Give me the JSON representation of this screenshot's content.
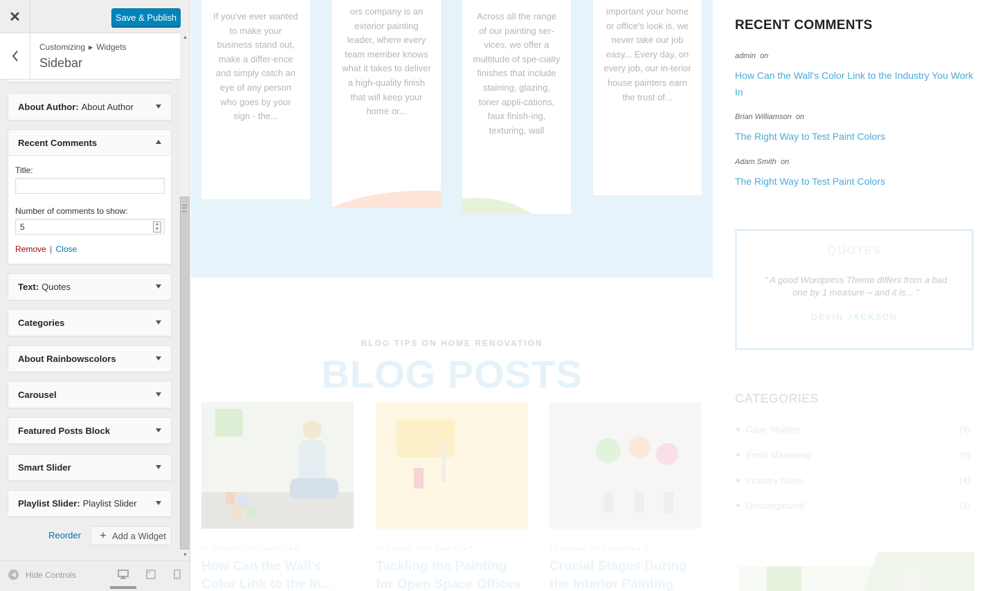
{
  "topbar": {
    "close_icon": "close-icon",
    "save_label": "Save & Publish",
    "save_color": "#0085ba"
  },
  "panel": {
    "breadcrumb_root": "Customizing",
    "breadcrumb_section": "Widgets",
    "title": "Sidebar"
  },
  "widgets": [
    {
      "name": "About Author:",
      "subtitle": "About Author"
    },
    {
      "name": "Recent Comments",
      "subtitle": ""
    },
    {
      "name": "Text:",
      "subtitle": "Quotes"
    },
    {
      "name": "Categories",
      "subtitle": ""
    },
    {
      "name": "About Rainbowscolors",
      "subtitle": ""
    },
    {
      "name": "Carousel",
      "subtitle": ""
    },
    {
      "name": "Featured Posts Block",
      "subtitle": ""
    },
    {
      "name": "Smart Slider",
      "subtitle": ""
    },
    {
      "name": "Playlist Slider:",
      "subtitle": "Playlist Slider"
    }
  ],
  "recent_comments_form": {
    "title_label": "Title:",
    "title_value": "",
    "number_label": "Number of comments to show:",
    "number_value": "5",
    "remove_label": "Remove",
    "separator": "|",
    "close_label": "Close"
  },
  "bottom_actions": {
    "reorder_label": "Reorder",
    "add_widget_label": "Add a Widget"
  },
  "footer": {
    "hide_controls_label": "Hide Controls"
  },
  "preview": {
    "services": [
      "If you've ever wanted to make your business stand out, make a differ-ence and simply catch an eye of any person who goes by your sign - the...",
      "ors company is an exterior painting leader, where every team member knows what it takes to deliver a high-quality finish that will keep your home or...",
      "Across all the range of our painting ser-vices, we offer a multitude of spe-cialty finishes that include staining, glazing, toner appli-cations, faux finish-ing, texturing, wall",
      "important your home or office's look is, we never take our job easy... Every day, on every job, our in-terior house painters earn the trust of..."
    ],
    "blog_kicker": "BLOG TIPS ON HOME RENOVATION",
    "blog_title": "BLOG POSTS",
    "posts": [
      {
        "meta": "25 October 2016   Davi-ss   ● 0",
        "title": "How Can the Wall's Color Link to the In..."
      },
      {
        "meta": "25 October 2016   Davi-ss   ● 0",
        "title": "Tackling the Painting for Open Space Offices"
      },
      {
        "meta": "25 October 2016   Davi-ss   ● 0",
        "title": "Crucial Stages During the Interior Painting"
      }
    ],
    "recent_comments": {
      "heading": "RECENT COMMENTS",
      "items": [
        {
          "author": "admin",
          "on": "on",
          "link": "How Can the Wall's Color Link to the Industry You Work In"
        },
        {
          "author": "Brian Williamson",
          "on": "on",
          "link": "The Right Way to Test Paint Colors"
        },
        {
          "author": "Adam Smith",
          "on": "on",
          "link": "The Right Way to Test Paint Colors"
        }
      ]
    },
    "quotes": {
      "title": "QUOTES",
      "text": "\" A good Wordpress Theme differs from a bad one by 1 measure – and it is... \"",
      "author": "DEVIN JACKSON"
    },
    "categories": {
      "heading": "CATEGORIES",
      "items": [
        {
          "name": "Case Studies",
          "count": "(4)"
        },
        {
          "name": "Email Marketing",
          "count": "(5)"
        },
        {
          "name": "Industry News",
          "count": "(4)"
        },
        {
          "name": "Uncategorized",
          "count": "(3)"
        }
      ]
    },
    "link_color": "#4da9d8"
  }
}
